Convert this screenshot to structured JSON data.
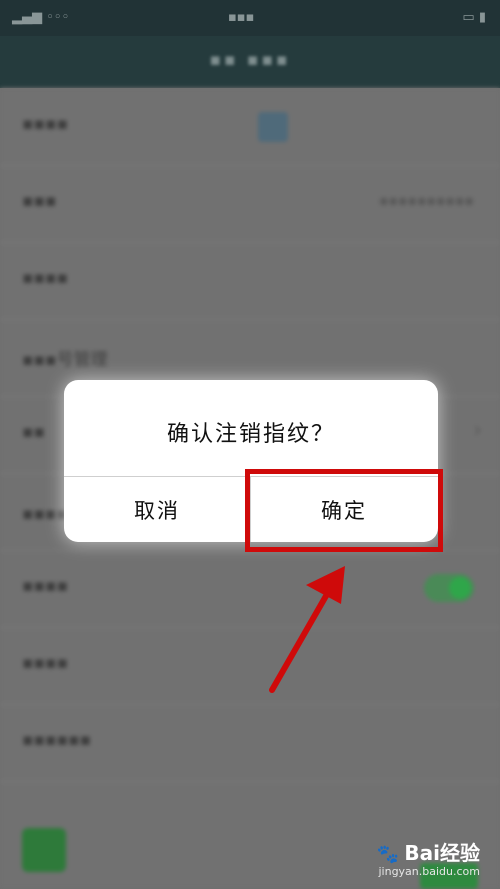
{
  "dialog": {
    "message": "确认注销指纹？",
    "cancel_label": "取消",
    "confirm_label": "确定"
  },
  "background_list": {
    "rows": [
      {
        "label": "",
        "kind": "avatar"
      },
      {
        "label": "",
        "kind": "value"
      },
      {
        "label": "",
        "kind": "plain"
      },
      {
        "label": "号管理",
        "kind": "plain"
      },
      {
        "label": "",
        "kind": "chevron"
      },
      {
        "label": "管理",
        "kind": "plain"
      },
      {
        "label": "",
        "kind": "toggle"
      },
      {
        "label": "",
        "kind": "plain"
      },
      {
        "label": "",
        "kind": "plain"
      }
    ]
  },
  "watermark": {
    "brand": "Bai经验",
    "url": "jingyan.baidu.com"
  },
  "colors": {
    "highlight": "#cf0a0a",
    "header": "#253b3d",
    "toggle_on": "#2fa64a"
  },
  "icons": [
    "chevron-right-icon",
    "arrow-annotation-icon",
    "paw-logo-icon"
  ]
}
